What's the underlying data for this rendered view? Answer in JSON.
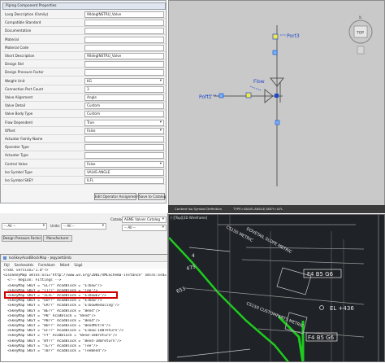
{
  "properties_panel": {
    "title": "Piping Component Properties",
    "rows": [
      {
        "label": "Long Description (Family)",
        "value": "90degINSTRU_Valve"
      },
      {
        "label": "Compatible Standard",
        "value": ""
      },
      {
        "label": "Documentation",
        "value": ""
      },
      {
        "label": "Material",
        "value": ""
      },
      {
        "label": "Material Code",
        "value": ""
      },
      {
        "label": "Short Description",
        "value": "90degINSTRU_Valve"
      },
      {
        "label": "Design Std",
        "value": ""
      },
      {
        "label": "Design Pressure Factor",
        "value": ""
      },
      {
        "label": "Weight Unit",
        "value": "KG"
      },
      {
        "label": "Connection Port Count",
        "value": "3"
      },
      {
        "label": "Valve Alignment",
        "value": "Angle"
      },
      {
        "label": "Valve Detail",
        "value": "Custom"
      },
      {
        "label": "Valve Body Type",
        "value": "Custom"
      },
      {
        "label": "Flow Dependent",
        "value": "True"
      },
      {
        "label": "Offset",
        "value": "False"
      },
      {
        "label": "Actuator Family Name",
        "value": ""
      },
      {
        "label": "Operator Type",
        "value": ""
      },
      {
        "label": "Actuator Type",
        "value": ""
      },
      {
        "label": "Control Valve",
        "value": "False"
      },
      {
        "label": "Iso Symbol Type",
        "value": "VALVE-ANGLE"
      },
      {
        "label": "Iso Symbol SKEY",
        "value": "ILFL"
      }
    ],
    "buttons": {
      "edit_operator": "Edit Operator Assignments",
      "save_to_catalog": "Save to Catalog"
    }
  },
  "viewport_top": {
    "labels": {
      "port3": "Port3",
      "flow": "Flow",
      "port1": "Port1",
      "top": "TOP"
    },
    "status_left": "Content Iso Symbol Definition",
    "status_right": "TYPE=VALVE-ANGLE,SKEY=ILFL"
  },
  "catalog_strip": {
    "filter1": "-- All --",
    "units_label": "Units:",
    "units_value": "-- All --",
    "catalog_label": "Catalog:",
    "catalog_value": "ASME Valves Catalog",
    "filter2": "-- All --",
    "tabs": [
      "Design Pressure Factor",
      "Manufacturer"
    ]
  },
  "xml_window": {
    "title": "IsoSkeyAcadBlockMap - Jegyzettömb",
    "menu": [
      "Fájl",
      "Szerkesztés",
      "Formátum",
      "Nézet",
      "Súgó"
    ],
    "lines": [
      "<?xml version=\"1.0\"?>",
      "<IsoSkeyMap xmlns:xsi=\"http://www.w3.org/2001/XMLSchema-instance\" xmlns:xsd=",
      "  <!-- Region: Fittings -->",
      "  <SkeyMap SKEY = \"EL??\" AcadBlock = \"Elbow\"/>",
      "  <SkeyMap SKEY = \"TT??\" AcadBlock = \"Tee\"/>",
      "  <SkeyMap SKEY = \"ILFL\" AcadBlock = \"ElbowEv\"/>",
      "  <SkeyMap SKEY = \"EU??\" AcadBlock = \"Elbow\"/>",
      "  <SkeyMap SKEY = \"ER??\" AcadBlock = \"ElbowReducing\"/>",
      "  <SkeyMap SKEY = \"BE??\" AcadBlock = \"Bend\"/>",
      "  <SkeyMap SKEY = \"PB\" AcadBlock = \"Bend\"/>",
      "  <SkeyMap SKEY = \"PB??\" AcadBlock = \"Bend\"/>",
      "  <SkeyMap SKEY = \"BU??\" AcadBlock = \"BendMitre\"/>",
      "  <SkeyMap SKEY = \"EF??\" AcadBlock = \"Elbow-180return\"/>",
      "  <SkeyMap SKEY = \"FY\" AcadBlock = \"Bend-180return\"/>",
      "  <SkeyMap SKEY = \"BY??\" AcadBlock = \"Bend-180return\"/>",
      "  <SkeyMap SKEY = \"TE??\" AcadBlock = \"Tee\"/>",
      "  <SkeyMap SKEY = \"TB??\" AcadBlock = \"TeeBend\"/>"
    ]
  },
  "viewport_bottom": {
    "header": "[-][Top][2D Wireframe]",
    "labels": [
      "CS150 METRIC",
      "DOVETAIL SLOPE METRIC",
      "4",
      "475",
      "653",
      "F4 B5 G6",
      "EL +436",
      "CS150 CUSTOMPARTS METRIC",
      "F4 B5 G6"
    ]
  },
  "colors": {
    "highlight": "#d00000",
    "pipe_green": "#1ecb1e",
    "marker_yellow": "#f2e84a",
    "port_blue": "#1e49c9"
  }
}
